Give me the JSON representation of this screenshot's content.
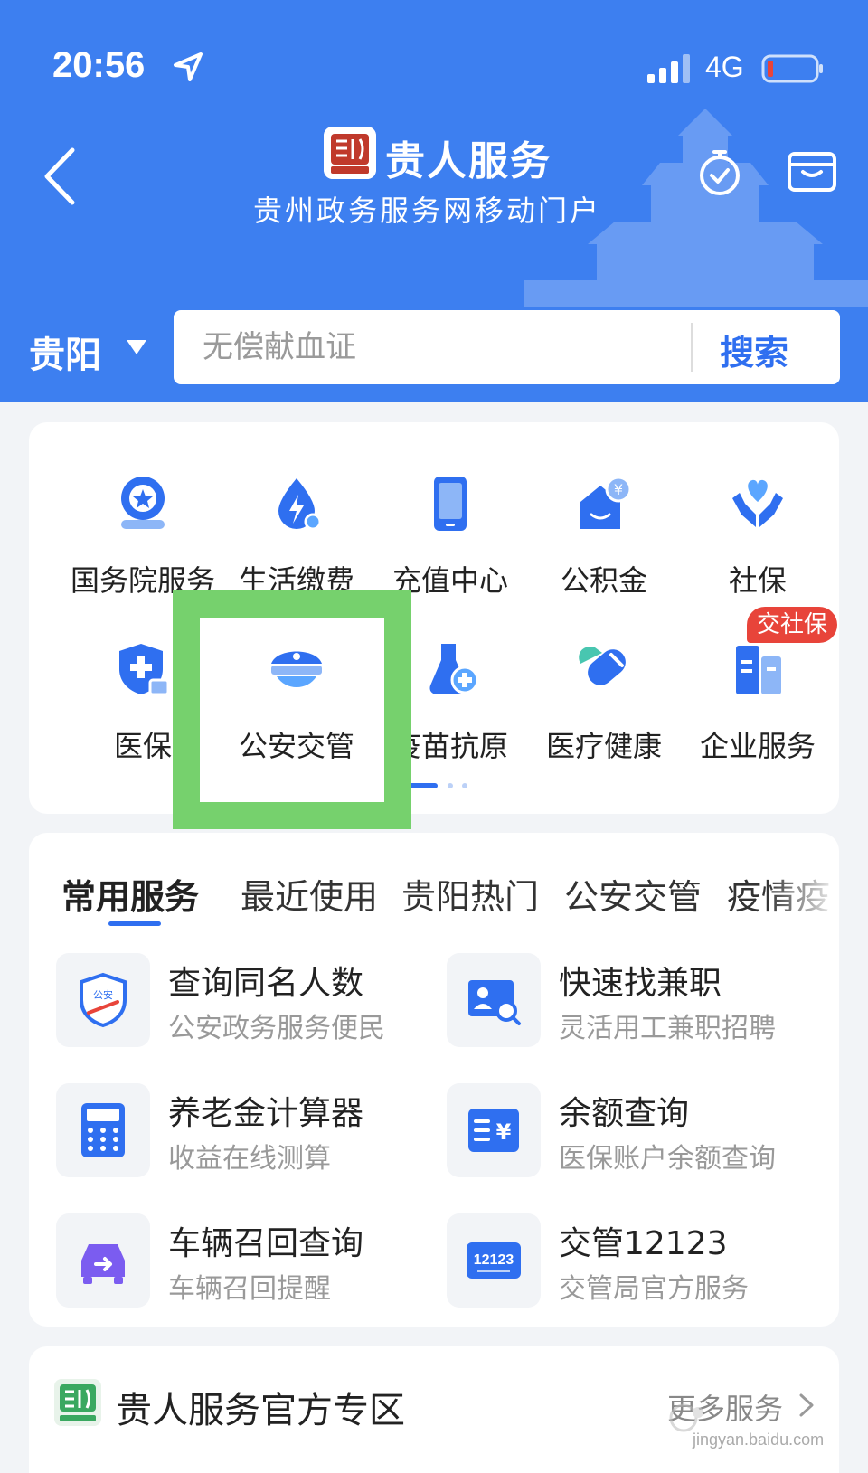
{
  "status_bar": {
    "time": "20:56",
    "network": "4G"
  },
  "header": {
    "title": "贵人服务",
    "subtitle": "贵州政务服务网移动门户"
  },
  "search": {
    "city": "贵阳",
    "placeholder": "无偿献血证",
    "button_label": "搜索"
  },
  "services": [
    {
      "label": "国务院服务",
      "icon": "state-council-icon"
    },
    {
      "label": "生活缴费",
      "icon": "utility-payment-icon"
    },
    {
      "label": "充值中心",
      "icon": "phone-recharge-icon"
    },
    {
      "label": "公积金",
      "icon": "housing-fund-icon"
    },
    {
      "label": "社保",
      "icon": "social-security-icon"
    },
    {
      "label": "医保",
      "icon": "medical-insurance-icon"
    },
    {
      "label": "公安交管",
      "icon": "police-cap-icon"
    },
    {
      "label": "疫苗抗原",
      "icon": "vaccine-icon"
    },
    {
      "label": "医疗健康",
      "icon": "health-icon"
    },
    {
      "label": "企业服务",
      "icon": "enterprise-icon"
    }
  ],
  "badge": "交社保",
  "tabs": [
    "常用服务",
    "最近使用",
    "贵阳热门",
    "公安交管",
    "疫情疫"
  ],
  "common_items": [
    {
      "title": "查询同名人数",
      "subtitle": "公安政务服务便民",
      "icon": "police-shield-icon"
    },
    {
      "title": "快速找兼职",
      "subtitle": "灵活用工兼职招聘",
      "icon": "job-search-icon"
    },
    {
      "title": "养老金计算器",
      "subtitle": "收益在线测算",
      "icon": "calculator-icon"
    },
    {
      "title": "余额查询",
      "subtitle": "医保账户余额查询",
      "icon": "balance-icon"
    },
    {
      "title": "车辆召回查询",
      "subtitle": "车辆召回提醒",
      "icon": "car-recall-icon"
    },
    {
      "title": "交管12123",
      "subtitle": "交管局官方服务",
      "icon": "traffic-12123-icon",
      "icon_text": "12123"
    }
  ],
  "official": {
    "title": "贵人服务官方专区",
    "more": "更多服务"
  },
  "watermark": {
    "domain": "jingyan.baidu.com"
  },
  "colors": {
    "primary": "#3d7ff0",
    "accent": "#2f6ff0",
    "highlight": "#76d16d",
    "badge": "#e8443a"
  }
}
